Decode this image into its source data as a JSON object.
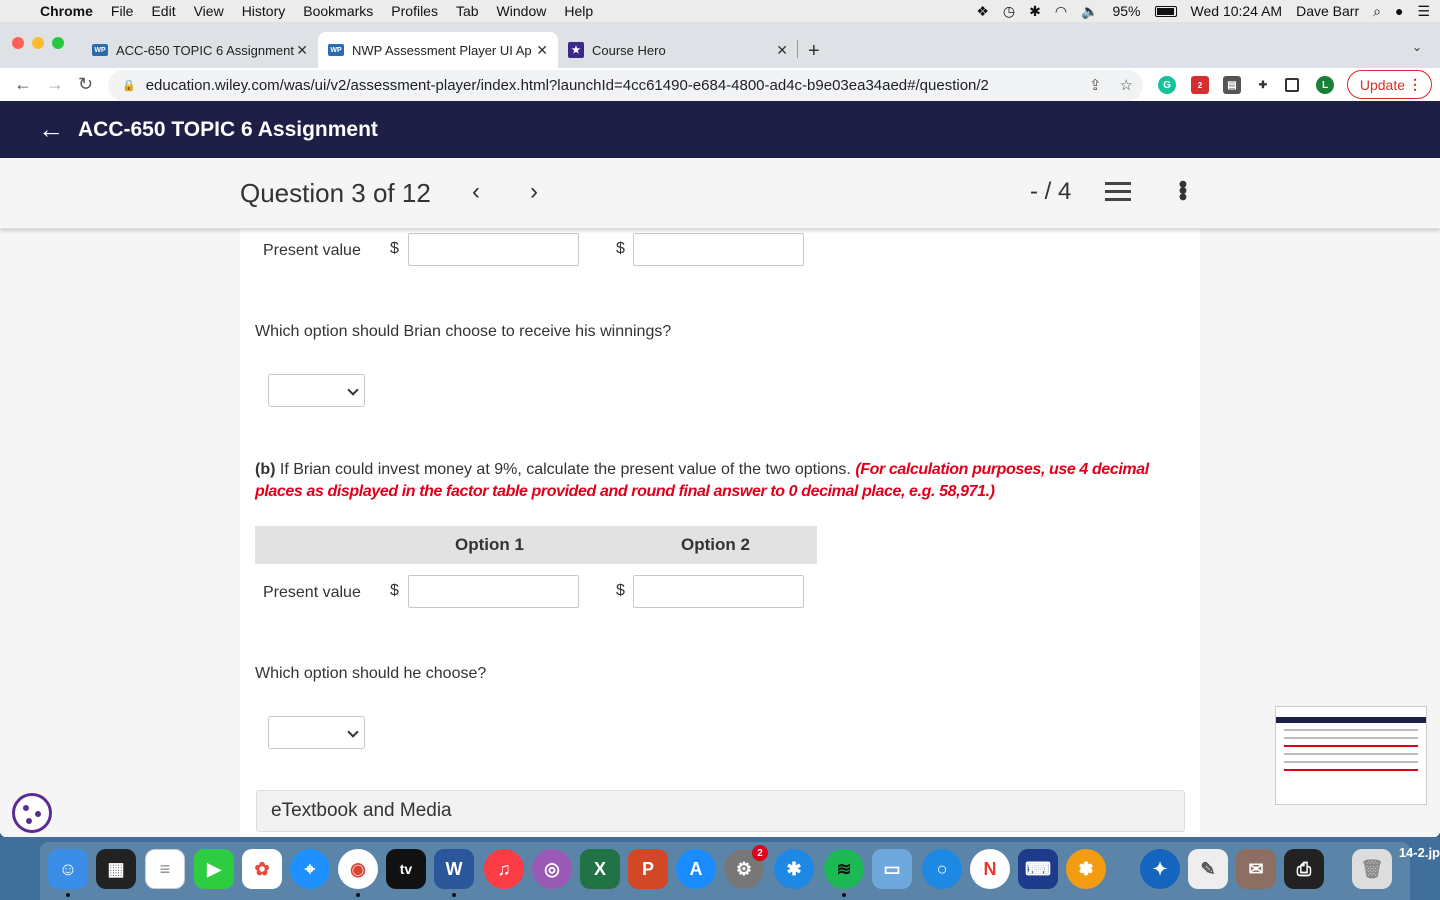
{
  "menubar": {
    "app": "Chrome",
    "items": [
      "File",
      "Edit",
      "View",
      "History",
      "Bookmarks",
      "Profiles",
      "Tab",
      "Window",
      "Help"
    ],
    "battery": "95%",
    "clock": "Wed 10:24 AM",
    "user": "Dave Barr"
  },
  "tabs": [
    {
      "label": "ACC-650 TOPIC 6 Assignment",
      "favicon": "WP"
    },
    {
      "label": "NWP Assessment Player UI Ap",
      "favicon": "WP"
    },
    {
      "label": "Course Hero",
      "favicon": "★"
    }
  ],
  "browser": {
    "url": "education.wiley.com/was/ui/v2/assessment-player/index.html?launchId=4cc61490-e684-4800-ad4c-b9e03ea34aed#/question/2",
    "update_label": "Update",
    "profile_initial": "L",
    "ext_badge": "2"
  },
  "header": {
    "title": "ACC-650 TOPIC 6 Assignment"
  },
  "question_bar": {
    "title": "Question 3 of 12",
    "score": "- / 4"
  },
  "part_a": {
    "pv_label": "Present value",
    "currency": "$",
    "question": "Which option should Brian choose to receive his winnings?"
  },
  "part_b": {
    "prefix": "(b)",
    "text": " If Brian could invest money at 9%, calculate the present value of the two options. ",
    "instructions": "(For calculation purposes, use 4 decimal places as displayed in the factor table provided and round final answer to 0 decimal place, e.g. 58,971.)",
    "col1": "Option 1",
    "col2": "Option 2",
    "pv_label": "Present value",
    "currency": "$",
    "question": "Which option should he choose?"
  },
  "etextbook": {
    "label": "eTextbook and Media"
  },
  "dock": {
    "tv_label": "tv",
    "word_label": "W",
    "excel_label": "X",
    "ppt_label": "P",
    "settings_badge": "2",
    "desktop_label": "14-2.jp"
  }
}
